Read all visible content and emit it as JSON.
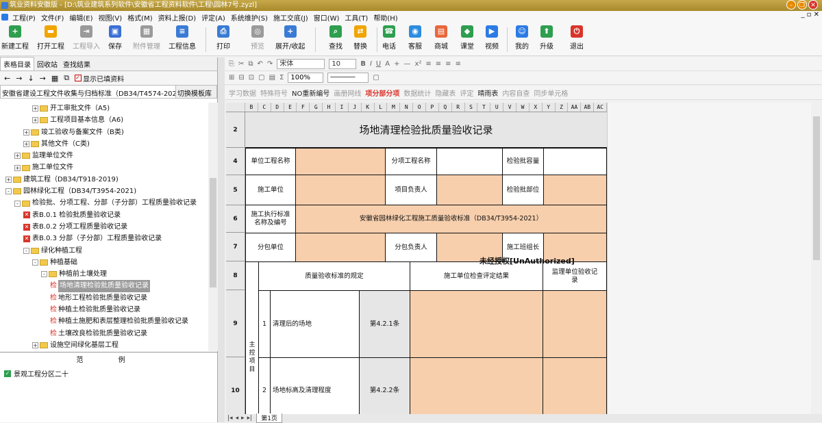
{
  "window": {
    "title": "筑业资料安徽版 - [D:\\筑业建筑系列软件\\安徽省工程资料软件\\工程\\园林7号.zyzl]"
  },
  "menu": [
    "工程(P)",
    "文件(F)",
    "编辑(E)",
    "视图(V)",
    "格式(M)",
    "资料上报(D)",
    "评定(A)",
    "系统维护(S)",
    "施工交底(J)",
    "窗口(W)",
    "工具(T)",
    "帮助(H)"
  ],
  "toolbar": [
    {
      "label": "新建工程",
      "icon": "new-project-icon",
      "color": "#2e9e4f",
      "glyph": "+",
      "enabled": true
    },
    {
      "label": "打开工程",
      "icon": "open-folder-icon",
      "color": "#f0a500",
      "glyph": "▬",
      "enabled": true
    },
    {
      "label": "工程导入",
      "icon": "import-icon",
      "color": "#9a9a9a",
      "glyph": "⇥",
      "enabled": false
    },
    {
      "label": "保存",
      "icon": "save-icon",
      "color": "#3a6fd5",
      "glyph": "▣",
      "enabled": true
    },
    {
      "label": "附件管理",
      "icon": "attachment-icon",
      "color": "#9a9a9a",
      "glyph": "▦",
      "enabled": false
    },
    {
      "label": "工程信息",
      "icon": "project-info-icon",
      "color": "#3a7bd5",
      "glyph": "≡",
      "enabled": true
    },
    {
      "label": "打印",
      "icon": "print-icon",
      "color": "#3a7bd5",
      "glyph": "⎙",
      "enabled": true
    },
    {
      "label": "预览",
      "icon": "preview-icon",
      "color": "#9a9a9a",
      "glyph": "◎",
      "enabled": false
    },
    {
      "label": "展开/收起",
      "icon": "expand-icon",
      "color": "#3a7bd5",
      "glyph": "+",
      "enabled": true
    },
    {
      "label": "查找",
      "icon": "find-icon",
      "color": "#2e9e4f",
      "glyph": "⌕",
      "enabled": true
    },
    {
      "label": "替换",
      "icon": "replace-icon",
      "color": "#f0a500",
      "glyph": "⇄",
      "enabled": true
    },
    {
      "label": "电话",
      "icon": "phone-icon",
      "color": "#2e9e4f",
      "glyph": "☎",
      "enabled": true
    },
    {
      "label": "客服",
      "icon": "support-icon",
      "color": "#2c8ce0",
      "glyph": "◉",
      "enabled": true
    },
    {
      "label": "商城",
      "icon": "shop-icon",
      "color": "#e8673c",
      "glyph": "▤",
      "enabled": true
    },
    {
      "label": "课堂",
      "icon": "classroom-icon",
      "color": "#2e9e4f",
      "glyph": "◆",
      "enabled": true
    },
    {
      "label": "视频",
      "icon": "video-icon",
      "color": "#2c7be5",
      "glyph": "▶",
      "enabled": true
    },
    {
      "label": "我的",
      "icon": "user-icon",
      "color": "#2c7be5",
      "glyph": "☺",
      "enabled": true
    },
    {
      "label": "升级",
      "icon": "upgrade-icon",
      "color": "#2e9e4f",
      "glyph": "⬆",
      "enabled": true
    },
    {
      "label": "退出",
      "icon": "exit-icon",
      "color": "#d9342b",
      "glyph": "⏻",
      "enabled": true
    }
  ],
  "left": {
    "tabs": [
      "表格目录",
      "回收站",
      "查找结果"
    ],
    "show_filled": "显示已填资料",
    "standard": "安徽省建设工程文件收集与归档标准（DB34/T4574-202",
    "switch_template": "切换模板库",
    "tree": [
      {
        "label": "开工审批文件（A5)",
        "indent": 3,
        "kind": "folder",
        "pm": "+"
      },
      {
        "label": "工程项目基本信息（A6)",
        "indent": 3,
        "kind": "folder",
        "pm": "+"
      },
      {
        "label": "竣工验收与备案文件（B类)",
        "indent": 2,
        "kind": "folder",
        "pm": "+"
      },
      {
        "label": "其他文件（C类)",
        "indent": 2,
        "kind": "folder",
        "pm": "+"
      },
      {
        "label": "监理单位文件",
        "indent": 1,
        "kind": "folder",
        "pm": "+"
      },
      {
        "label": "施工单位文件",
        "indent": 1,
        "kind": "folder",
        "pm": "+"
      },
      {
        "label": "建筑工程（DB34/T918-2019)",
        "indent": 0,
        "kind": "folder",
        "pm": "+"
      },
      {
        "label": "园林绿化工程（DB34/T3954-2021)",
        "indent": 0,
        "kind": "folder",
        "pm": "-"
      },
      {
        "label": "检验批、分项工程、分部（子分部）工程质量验收记录",
        "indent": 1,
        "kind": "folder",
        "pm": "-"
      },
      {
        "label": "表B.0.1 检验批质量验收记录",
        "indent": 2,
        "kind": "x"
      },
      {
        "label": "表B.0.2 分项工程质量验收记录",
        "indent": 2,
        "kind": "x"
      },
      {
        "label": "表B.0.3 分部（子分部）工程质量验收记录",
        "indent": 2,
        "kind": "x"
      },
      {
        "label": "绿化种植工程",
        "indent": 2,
        "kind": "folder",
        "pm": "-"
      },
      {
        "label": "种植基础",
        "indent": 3,
        "kind": "folder",
        "pm": "-"
      },
      {
        "label": "种植前土壤处理",
        "indent": 4,
        "kind": "folder",
        "pm": "-"
      },
      {
        "label": "场地清理检验批质量验收记录",
        "indent": 5,
        "kind": "jian",
        "selected": true
      },
      {
        "label": "地形工程检验批质量验收记录",
        "indent": 5,
        "kind": "jian"
      },
      {
        "label": "种植土检验批质量验收记录",
        "indent": 5,
        "kind": "jian"
      },
      {
        "label": "种植土施肥和表层整理检验批质量验收记录",
        "indent": 5,
        "kind": "jian"
      },
      {
        "label": "土壤改良检验批质量验收记录",
        "indent": 5,
        "kind": "jian"
      },
      {
        "label": "设施空间绿化基层工程",
        "indent": 3,
        "kind": "folder",
        "pm": "+"
      }
    ],
    "legend_title": "范 例",
    "legend_item": "景观工程分区二十"
  },
  "format": {
    "font": "宋体",
    "size": "10",
    "zoom": "100%",
    "row3": [
      "学习数据",
      "特殊符号",
      "NO重新编号",
      "画册网线",
      "项分部分项",
      "数据统计",
      "隐藏表",
      "评定",
      "晴雨表",
      "内容自查",
      "同步单元格"
    ]
  },
  "columns": [
    "B",
    "C",
    "D",
    "E",
    "F",
    "G",
    "H",
    "I",
    "J",
    "K",
    "L",
    "M",
    "N",
    "O",
    "P",
    "Q",
    "R",
    "S",
    "T",
    "U",
    "V",
    "W",
    "X",
    "Y",
    "Z",
    "AA",
    "AB",
    "AC"
  ],
  "form": {
    "title": "场地清理检验批质量验收记录",
    "rows": [
      "2",
      "4",
      "5",
      "6",
      "7",
      "8",
      "9",
      "10"
    ],
    "unit_project": "单位工程名称",
    "sub_project": "分项工程名称",
    "batch_capacity": "检验批容量",
    "construction_unit": "施工单位",
    "project_leader": "项目负责人",
    "batch_part": "检验批部位",
    "exec_standard": "施工执行标准名称及编号",
    "standard_value": "安徽省园林绿化工程施工质量验收标准（DB34/T3954-2021）",
    "subcontractor": "分包单位",
    "sub_leader": "分包负责人",
    "team_leader": "施工班组长",
    "quality_rules": "质量验收标准的规定",
    "check_result": "施工单位检查评定结果",
    "supervisor": "监理单位验收记录",
    "main_items": "主控项目",
    "item1_no": "1",
    "item1": "清理后的场地",
    "item1_clause": "第4.2.1条",
    "item2_no": "2",
    "item2": "场地标高及清理程度",
    "item2_clause": "第4.2.2条"
  },
  "watermark": "未经授权[UnAuthorized]",
  "sheet_tab": "第1页"
}
